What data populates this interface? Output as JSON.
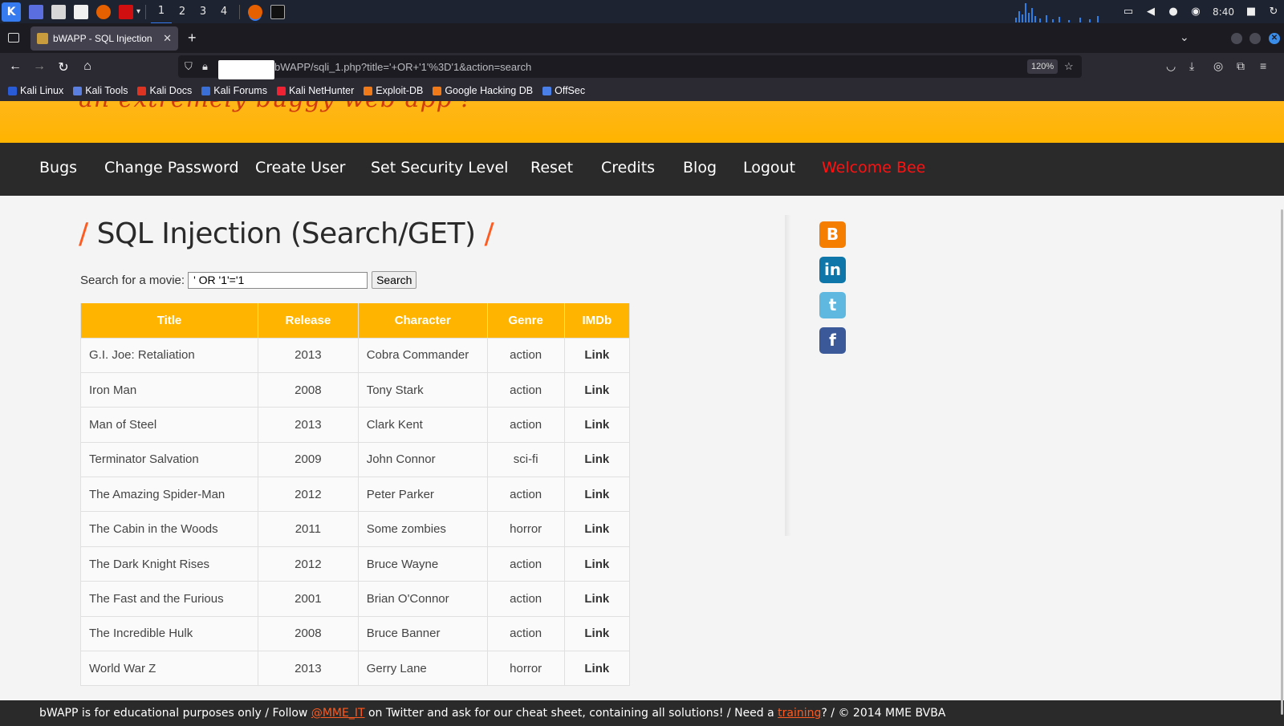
{
  "taskbar": {
    "workspaces": [
      "1",
      "2",
      "3",
      "4"
    ],
    "clock": "8:40"
  },
  "browser": {
    "tab_title": "bWAPP - SQL Injection",
    "url": "bWAPP/sqli_1.php?title='+OR+'1'%3D'1&action=search",
    "zoom": "120%",
    "bookmarks": [
      "Kali Linux",
      "Kali Tools",
      "Kali Docs",
      "Kali Forums",
      "Kali NetHunter",
      "Exploit-DB",
      "Google Hacking DB",
      "OffSec"
    ]
  },
  "header": {
    "tagline": "an extremely buggy web app !"
  },
  "menu": {
    "items": [
      "Bugs",
      "Change Password",
      "Create User",
      "Set Security Level",
      "Reset",
      "Credits",
      "Blog",
      "Logout"
    ],
    "welcome": "Welcome Bee"
  },
  "main": {
    "title_slash_left": "/",
    "title": "SQL Injection (Search/GET)",
    "title_slash_right": "/",
    "search_label": "Search for a movie:",
    "search_value": "' OR '1'='1",
    "search_button": "Search",
    "table": {
      "headers": [
        "Title",
        "Release",
        "Character",
        "Genre",
        "IMDb"
      ],
      "rows": [
        [
          "G.I. Joe: Retaliation",
          "2013",
          "Cobra Commander",
          "action",
          "Link"
        ],
        [
          "Iron Man",
          "2008",
          "Tony Stark",
          "action",
          "Link"
        ],
        [
          "Man of Steel",
          "2013",
          "Clark Kent",
          "action",
          "Link"
        ],
        [
          "Terminator Salvation",
          "2009",
          "John Connor",
          "sci-fi",
          "Link"
        ],
        [
          "The Amazing Spider-Man",
          "2012",
          "Peter Parker",
          "action",
          "Link"
        ],
        [
          "The Cabin in the Woods",
          "2011",
          "Some zombies",
          "horror",
          "Link"
        ],
        [
          "The Dark Knight Rises",
          "2012",
          "Bruce Wayne",
          "action",
          "Link"
        ],
        [
          "The Fast and the Furious",
          "2001",
          "Brian O'Connor",
          "action",
          "Link"
        ],
        [
          "The Incredible Hulk",
          "2008",
          "Bruce Banner",
          "action",
          "Link"
        ],
        [
          "World War Z",
          "2013",
          "Gerry Lane",
          "horror",
          "Link"
        ]
      ]
    }
  },
  "social": [
    {
      "icon": "blogger-icon",
      "glyph": "B",
      "color": "#f57d00"
    },
    {
      "icon": "linkedin-icon",
      "glyph": "in",
      "color": "#0e76a8"
    },
    {
      "icon": "twitter-icon",
      "glyph": "t",
      "color": "#5fb8e0"
    },
    {
      "icon": "facebook-icon",
      "glyph": "f",
      "color": "#3b5998"
    }
  ],
  "footer": {
    "text1": "bWAPP is for educational purposes only / Follow ",
    "link1": "@MME_IT",
    "text2": " on Twitter and ask for our cheat sheet, containing all solutions! / Need a ",
    "link2": "training",
    "text3": "? / © 2014 MME BVBA"
  },
  "colors": {
    "accent_orange": "#ffb500",
    "menu_bg": "#2a2a2a",
    "welcome_red": "#ff1111",
    "title_slash": "#ff5a1f"
  }
}
